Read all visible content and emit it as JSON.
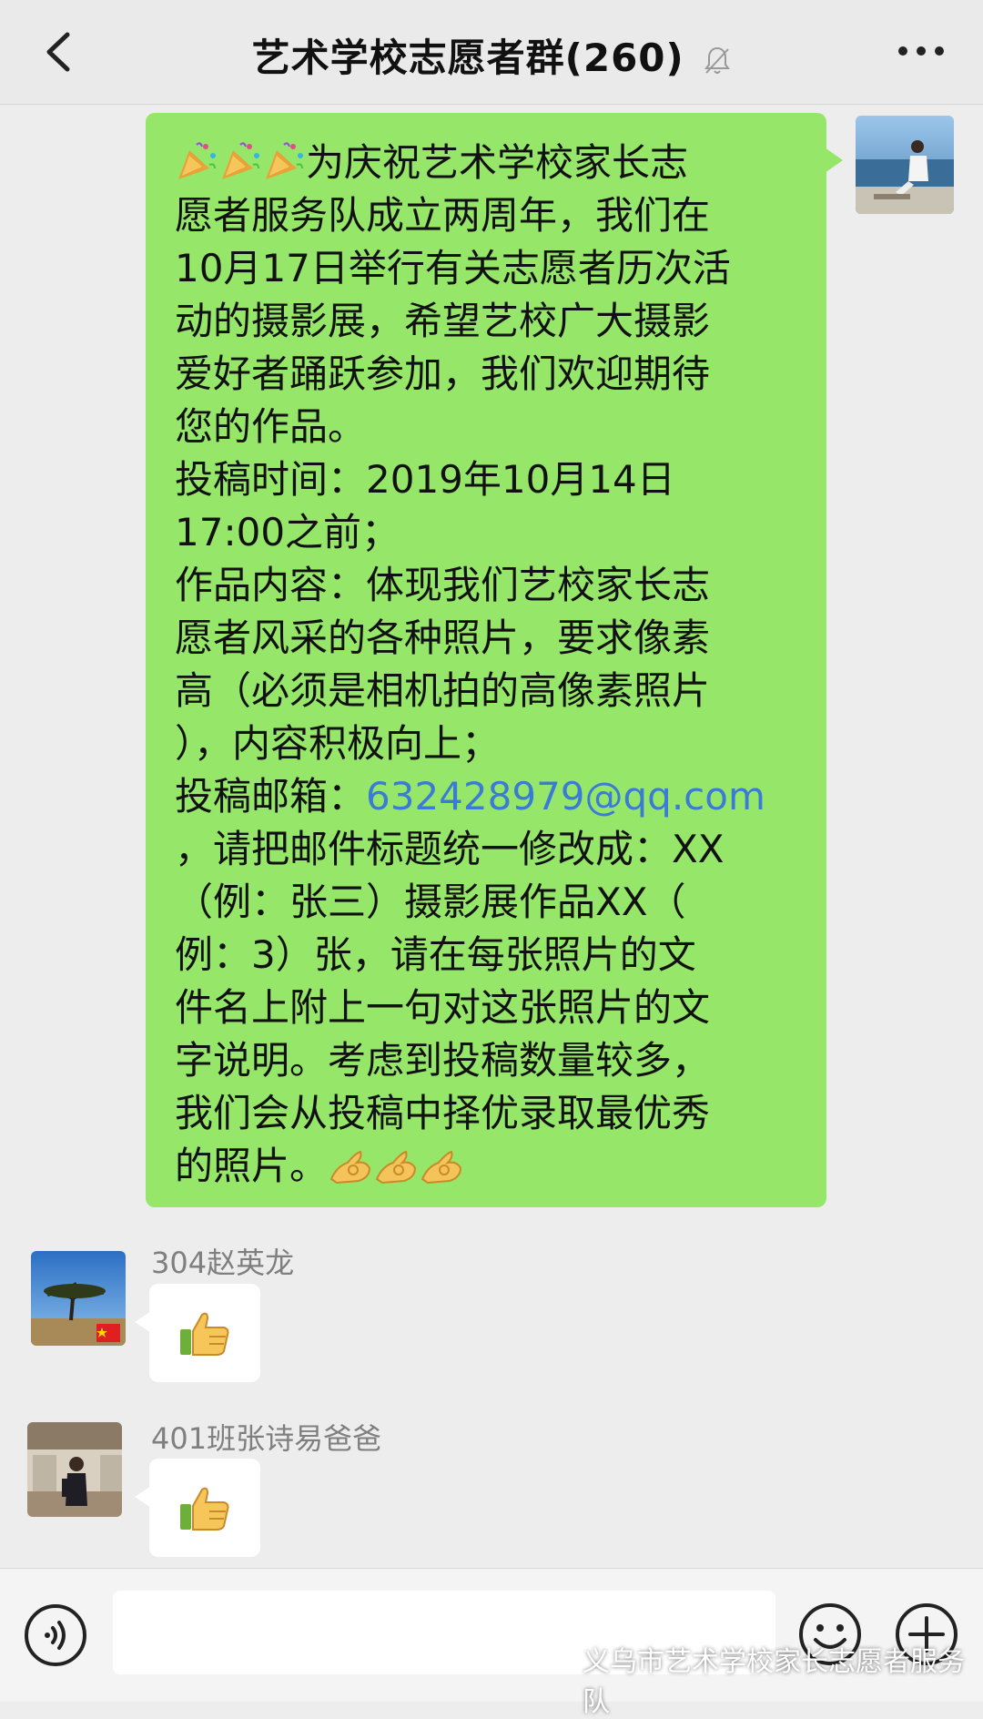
{
  "header": {
    "title": "艺术学校志愿者群",
    "member_count": "(260)"
  },
  "messages": {
    "announcement": {
      "lines": [
        "为庆祝艺术学校家长志",
        "愿者服务队成立两周年，我们在",
        "10月17日举行有关志愿者历次活",
        "动的摄影展，希望艺校广大摄影",
        "爱好者踊跃参加，我们欢迎期待",
        "您的作品。",
        "投稿时间：2019年10月14日",
        "17:00之前；",
        "作品内容：体现我们艺校家长志",
        "愿者风采的各种照片，要求像素",
        "高（必须是相机拍的高像素照片",
        "），内容积极向上；"
      ],
      "email_prefix": "投稿邮箱：",
      "email": "632428979@qq.com",
      "lines_after": [
        "，请把邮件标题统一修改成：XX",
        "（例：张三）摄影展作品XX（",
        "例：3）张，请在每张照片的文",
        "件名上附上一句对这张照片的文",
        "字说明。考虑到投稿数量较多，",
        "我们会从投稿中择优录取最优秀"
      ],
      "last_line": "的照片。"
    },
    "reply1": {
      "sender": "304赵英龙"
    },
    "reply2": {
      "sender": "401班张诗易爸爸"
    }
  },
  "watermark": "义乌市艺术学校家长志愿者服务队",
  "icons": {
    "back": "chevron-left-icon",
    "mute": "bell-off-icon",
    "more": "more-dots-icon",
    "voice": "voice-icon",
    "emoji": "smile-icon",
    "plus": "plus-icon",
    "thumbs": "thumbs-up-icon"
  },
  "colors": {
    "bubble_green": "#96e66a",
    "email_link": "#3a7bd5"
  }
}
